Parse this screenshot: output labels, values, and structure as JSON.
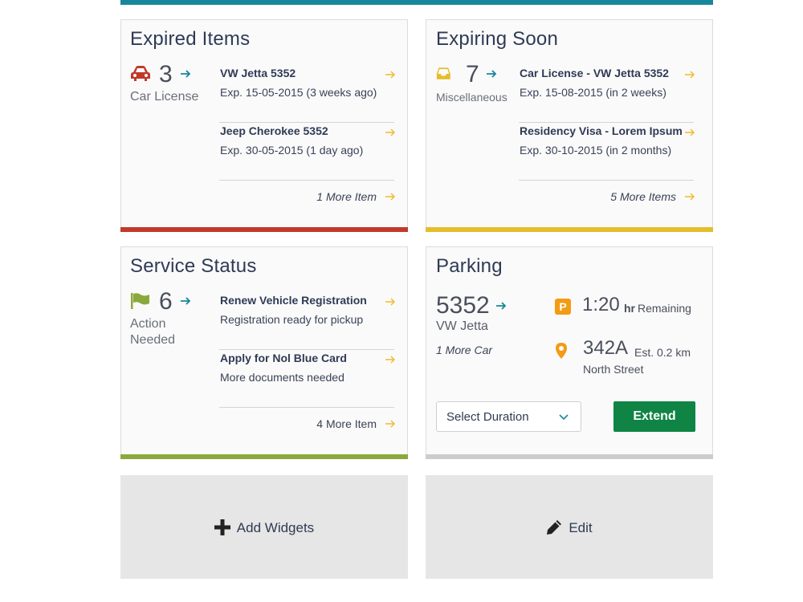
{
  "colors": {
    "teal": "#16879b",
    "expired_accent": "#c0392b",
    "expiring_accent": "#e5bd2a",
    "service_accent": "#8aa93d",
    "parking_accent": "#cccccc",
    "extend_button": "#0f8444",
    "p_badge": "#f39b13"
  },
  "expired": {
    "title": "Expired Items",
    "count": "3",
    "label": "Car License",
    "icon": "car-icon",
    "items": [
      {
        "title": "VW Jetta 5352",
        "sub": "Exp. 15-05-2015 (3 weeks ago)"
      },
      {
        "title": "Jeep Cherokee 5352",
        "sub": "Exp. 30-05-2015 (1 day ago)"
      }
    ],
    "more": "1 More Item"
  },
  "expiring": {
    "title": "Expiring Soon",
    "count": "7",
    "label": "Miscellaneous",
    "icon": "inbox-icon",
    "items": [
      {
        "title": "Car License - VW Jetta 5352",
        "sub": "Exp. 15-08-2015 (in 2 weeks)"
      },
      {
        "title": "Residency Visa - Lorem Ipsum",
        "sub": "Exp. 30-10-2015 (in 2 months)"
      }
    ],
    "more": "5 More Items"
  },
  "service": {
    "title": "Service Status",
    "count": "6",
    "label_line1": "Action",
    "label_line2": "Needed",
    "icon": "flag-icon",
    "items": [
      {
        "title": "Renew Vehicle Registration",
        "sub": "Registration ready for pickup"
      },
      {
        "title": "Apply for Nol Blue Card",
        "sub": "More documents needed"
      }
    ],
    "more": "4 More Item"
  },
  "parking": {
    "title": "Parking",
    "plate": "5352",
    "car": "VW Jetta",
    "more_car": "1 More Car",
    "badge": "P",
    "time": "1:20",
    "time_unit": "hr",
    "time_label": "Remaining",
    "spot": "342A",
    "distance": "Est. 0.2 km",
    "street": "North Street",
    "select_placeholder": "Select Duration",
    "extend_label": "Extend"
  },
  "tiles": {
    "add_widgets": "Add Widgets",
    "edit": "Edit"
  }
}
